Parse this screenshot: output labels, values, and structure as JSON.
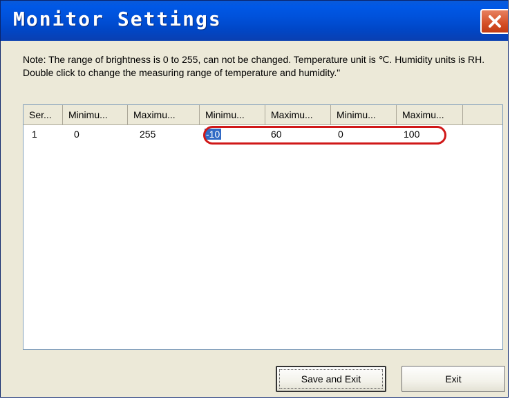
{
  "window": {
    "title": "Monitor Settings"
  },
  "note": "Note: The range of brightness is 0 to 255, can not be changed. Temperature unit is ℃. Humidity units is RH. Double click to change the measuring range of temperature and humidity.\"",
  "table": {
    "columns": [
      "Ser...",
      "Minimu...",
      "Maximu...",
      "Minimu...",
      "Maximu...",
      "Minimu...",
      "Maximu..."
    ],
    "rows": [
      [
        "1",
        "0",
        "255",
        "-10",
        "60",
        "0",
        "100"
      ]
    ]
  },
  "buttons": {
    "save_exit": "Save and Exit",
    "exit": "Exit"
  },
  "colors": {
    "highlight": "#d01818",
    "titlebar": "#0050d8",
    "selection": "#316ac5"
  },
  "icons": {
    "close": "close-icon"
  }
}
